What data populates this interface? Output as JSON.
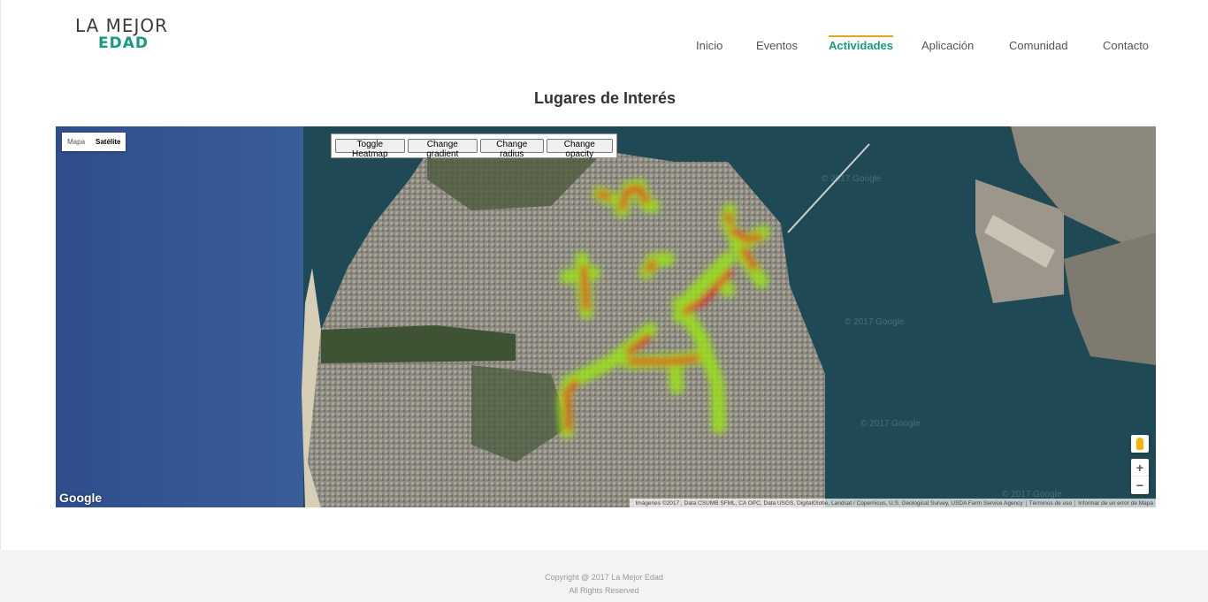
{
  "brand": {
    "line1": "LA MEJOR",
    "line2": "EDAD"
  },
  "nav": {
    "items": [
      {
        "label": "Inicio",
        "active": false
      },
      {
        "label": "Eventos",
        "active": false
      },
      {
        "label": "Actividades",
        "active": true
      },
      {
        "label": "Aplicación",
        "active": false
      },
      {
        "label": "Comunidad",
        "active": false
      },
      {
        "label": "Contacto",
        "active": false
      }
    ]
  },
  "page": {
    "title": "Lugares de Interés"
  },
  "map": {
    "type_toggle": {
      "map_label": "Mapa",
      "satellite_label": "Satélite",
      "selected": "Satélite"
    },
    "controls": {
      "toggle_heatmap": "Toggle Heatmap",
      "change_gradient": "Change gradient",
      "change_radius": "Change radius",
      "change_opacity": "Change opacity"
    },
    "watermark": "© 2017 Google",
    "logo": "Google",
    "attribution": {
      "imagery": "Imágenes ©2017 , Data CSUMB SFML, CA OPC, Data USGS, DigitalGlobe, Landsat / Copernicus, U.S. Geological Survey, USDA Farm Service Agency",
      "terms": "Términos de uso",
      "report": "Informar de un error de Mapa"
    },
    "zoom": {
      "in": "+",
      "out": "−"
    }
  },
  "footer": {
    "copyright": "Copyright @ 2017 La Mejor Edad",
    "rights": "All Rights Reserved"
  },
  "colors": {
    "accent": "#1a9a7c",
    "active_bar": "#e3a51a",
    "heat_hot": "#e01e1e",
    "heat_mid": "#9be21b"
  }
}
